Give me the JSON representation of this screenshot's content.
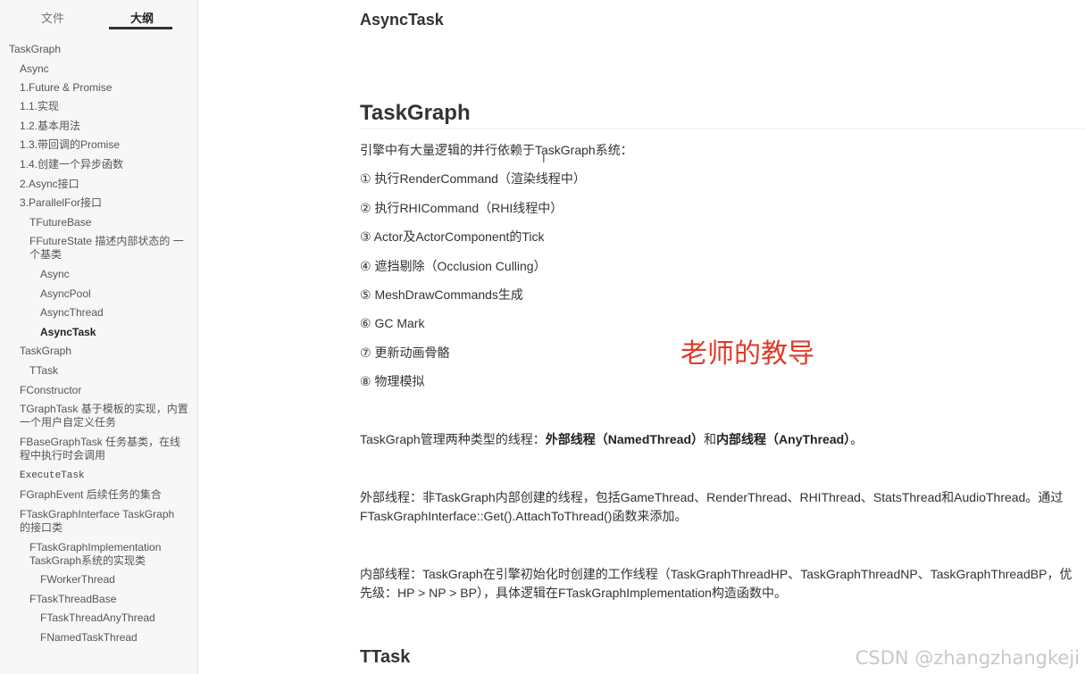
{
  "sidebar": {
    "tabs": {
      "files": "文件",
      "outline": "大纲"
    },
    "items": [
      "TaskGraph",
      "Async",
      "1.Future & Promise",
      "1.1.实现",
      "1.2.基本用法",
      "1.3.带回调的Promise",
      "1.4.创建一个异步函数",
      "2.Async接口",
      "3.ParallelFor接口",
      "TFutureBase",
      "FFutureState 描述内部状态的 一个基类",
      "Async",
      "AsyncPool",
      "AsyncThread",
      "AsyncTask",
      "TaskGraph",
      "TTask",
      "FConstructor",
      "TGraphTask 基于模板的实现，内置一个用户自定义任务",
      "FBaseGraphTask 任务基类，在线程中执行时会调用",
      "ExecuteTask",
      "FGraphEvent 后续任务的集合",
      "FTaskGraphInterface TaskGraph的接口类",
      "FTaskGraphImplementation TaskGraph系统的实现类",
      "FWorkerThread",
      "FTaskThreadBase",
      "FTaskThreadAnyThread",
      "FNamedTaskThread"
    ]
  },
  "main": {
    "heading_asynctask": "AsyncTask",
    "heading_taskgraph": "TaskGraph",
    "intro": "引擎中有大量逻辑的并行依赖于TaskGraph系统：",
    "caret": "I",
    "list": [
      "① 执行RenderCommand（渲染线程中）",
      "② 执行RHICommand（RHI线程中）",
      "③ Actor及ActorComponent的Tick",
      "④ 遮挡剔除（Occlusion Culling）",
      "⑤ MeshDrawCommands生成",
      "⑥ GC Mark",
      "⑦ 更新动画骨骼",
      "⑧ 物理模拟"
    ],
    "threads_prefix": "TaskGraph管理两种类型的线程：",
    "threads_external": "外部线程（NamedThread）",
    "threads_and": "和",
    "threads_internal": "内部线程（AnyThread）",
    "threads_end": "。",
    "external_desc": "外部线程：非TaskGraph内部创建的线程，包括GameThread、RenderThread、RHIThread、StatsThread和AudioThread。通过FTaskGraphInterface::Get().AttachToThread()函数来添加。",
    "internal_desc": "内部线程：TaskGraph在引擎初始化时创建的工作线程（TaskGraphThreadHP、TaskGraphThreadNP、TaskGraphThreadBP，优先级：HP > NP > BP），具体逻辑在FTaskGraphImplementation构造函数中。",
    "heading_ttask": "TTask",
    "overlay": "老师的教导",
    "watermark": "CSDN @zhangzhangkeji"
  }
}
